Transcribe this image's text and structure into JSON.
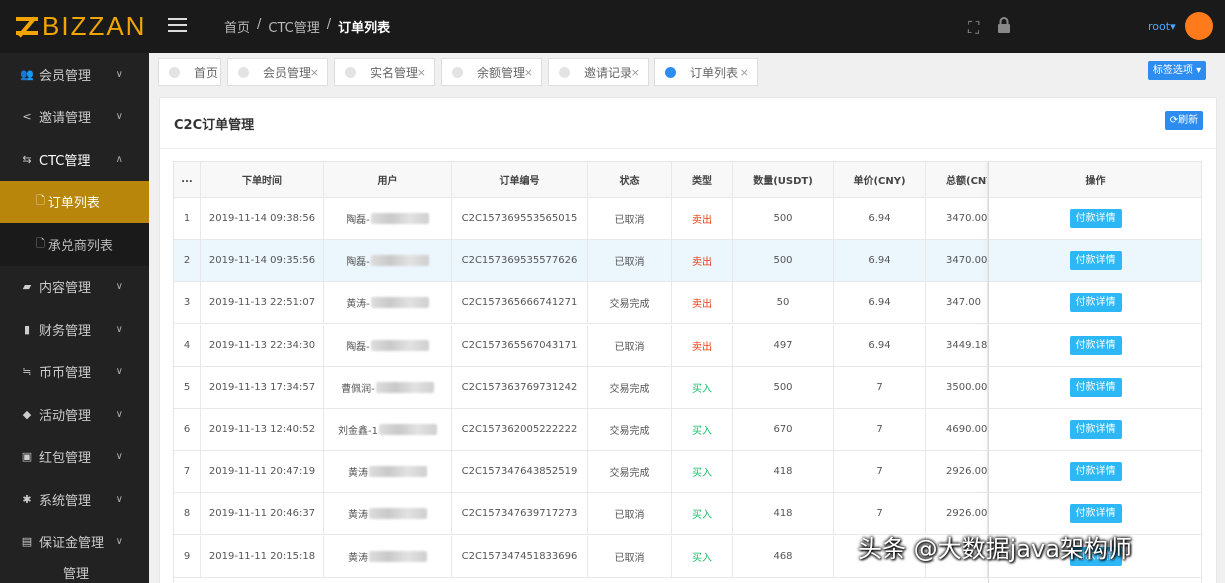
{
  "header": {
    "logo_text": "BIZZAN",
    "breadcrumb": [
      "首页",
      "CTC管理",
      "订单列表"
    ],
    "breadcrumb_sep": "/",
    "user": "root",
    "user_caret": "▾"
  },
  "sidebar": {
    "items": [
      {
        "label": "会员管理",
        "icon": "users-icon",
        "glyph": "👥",
        "arrow": "∨"
      },
      {
        "label": "邀请管理",
        "icon": "share-icon",
        "glyph": "<",
        "arrow": "∨"
      },
      {
        "label": "CTC管理",
        "icon": "exchange-icon",
        "glyph": "⇆",
        "arrow": "∧"
      },
      {
        "label": "内容管理",
        "icon": "folder-icon",
        "glyph": "▰",
        "arrow": "∨"
      },
      {
        "label": "财务管理",
        "icon": "bar-chart-icon",
        "glyph": "▮",
        "arrow": "∨"
      },
      {
        "label": "币币管理",
        "icon": "transfer-icon",
        "glyph": "≒",
        "arrow": "∨"
      },
      {
        "label": "活动管理",
        "icon": "cube-icon",
        "glyph": "◆",
        "arrow": "∨"
      },
      {
        "label": "红包管理",
        "icon": "wallet-icon",
        "glyph": "▣",
        "arrow": "∨"
      },
      {
        "label": "系统管理",
        "icon": "gear-icon",
        "glyph": "✱",
        "arrow": "∨"
      },
      {
        "label": "保证金管理",
        "icon": "card-icon",
        "glyph": "▤",
        "arrow": "∨"
      }
    ],
    "sub_items": [
      {
        "label": "订单列表",
        "glyph": "🗋"
      },
      {
        "label": "承兑商列表",
        "glyph": "🗋"
      }
    ],
    "bottom_partial": "管理"
  },
  "tabs": [
    {
      "label": "首页",
      "closable": false
    },
    {
      "label": "会员管理",
      "closable": true
    },
    {
      "label": "实名管理",
      "closable": true
    },
    {
      "label": "余额管理",
      "closable": true
    },
    {
      "label": "邀请记录",
      "closable": true
    },
    {
      "label": "订单列表",
      "closable": true,
      "active": true
    }
  ],
  "tab_close": "×",
  "tag_options": "标签选项 ▾",
  "card": {
    "title": "C2C订单管理",
    "refresh": "⟳刷新"
  },
  "table": {
    "headers": [
      "...",
      "下单时间",
      "用户",
      "订单编号",
      "状态",
      "类型",
      "数量(USDT)",
      "单价(CNY)",
      "总额(CNY)",
      "操作"
    ],
    "rows": [
      {
        "idx": "1",
        "time": "2019-11-14 09:38:56",
        "user": "陶磊-",
        "order": "C2C157369553565015",
        "status": "已取消",
        "type": "卖出",
        "qty": "500",
        "price": "6.94",
        "total": "3470.00",
        "action": "付款详情"
      },
      {
        "idx": "2",
        "time": "2019-11-14 09:35:56",
        "user": "陶磊-",
        "order": "C2C157369535577626",
        "status": "已取消",
        "type": "卖出",
        "qty": "500",
        "price": "6.94",
        "total": "3470.00",
        "action": "付款详情"
      },
      {
        "idx": "3",
        "time": "2019-11-13 22:51:07",
        "user": "黄涛-",
        "order": "C2C157365666741271",
        "status": "交易完成",
        "type": "卖出",
        "qty": "50",
        "price": "6.94",
        "total": "347.00",
        "action": "付款详情"
      },
      {
        "idx": "4",
        "time": "2019-11-13 22:34:30",
        "user": "陶磊-",
        "order": "C2C157365567043171",
        "status": "已取消",
        "type": "卖出",
        "qty": "497",
        "price": "6.94",
        "total": "3449.18",
        "action": "付款详情"
      },
      {
        "idx": "5",
        "time": "2019-11-13 17:34:57",
        "user": "曹佩润-",
        "order": "C2C157363769731242",
        "status": "交易完成",
        "type": "买入",
        "qty": "500",
        "price": "7",
        "total": "3500.00",
        "action": "付款详情"
      },
      {
        "idx": "6",
        "time": "2019-11-13 12:40:52",
        "user": "刘金鑫-1",
        "order": "C2C157362005222222",
        "status": "交易完成",
        "type": "买入",
        "qty": "670",
        "price": "7",
        "total": "4690.00",
        "action": "付款详情"
      },
      {
        "idx": "7",
        "time": "2019-11-11 20:47:19",
        "user": "黄涛",
        "order": "C2C157347643852519",
        "status": "交易完成",
        "type": "买入",
        "qty": "418",
        "price": "7",
        "total": "2926.00",
        "action": "付款详情"
      },
      {
        "idx": "8",
        "time": "2019-11-11 20:46:37",
        "user": "黄涛",
        "order": "C2C157347639717273",
        "status": "已取消",
        "type": "买入",
        "qty": "418",
        "price": "7",
        "total": "2926.00",
        "action": "付款详情"
      },
      {
        "idx": "9",
        "time": "2019-11-11 20:15:18",
        "user": "黄涛",
        "order": "C2C157347451833696",
        "status": "已取消",
        "type": "买入",
        "qty": "468",
        "price": "",
        "total": "",
        "action": "付款详情"
      }
    ]
  },
  "watermark": "头条 @大数据java架构师",
  "colors": {
    "accent": "#2d8cf0",
    "logo": "#f0a500",
    "sell": "#ed3f14",
    "buy": "#19be6b",
    "active_menu": "#b8860b"
  }
}
